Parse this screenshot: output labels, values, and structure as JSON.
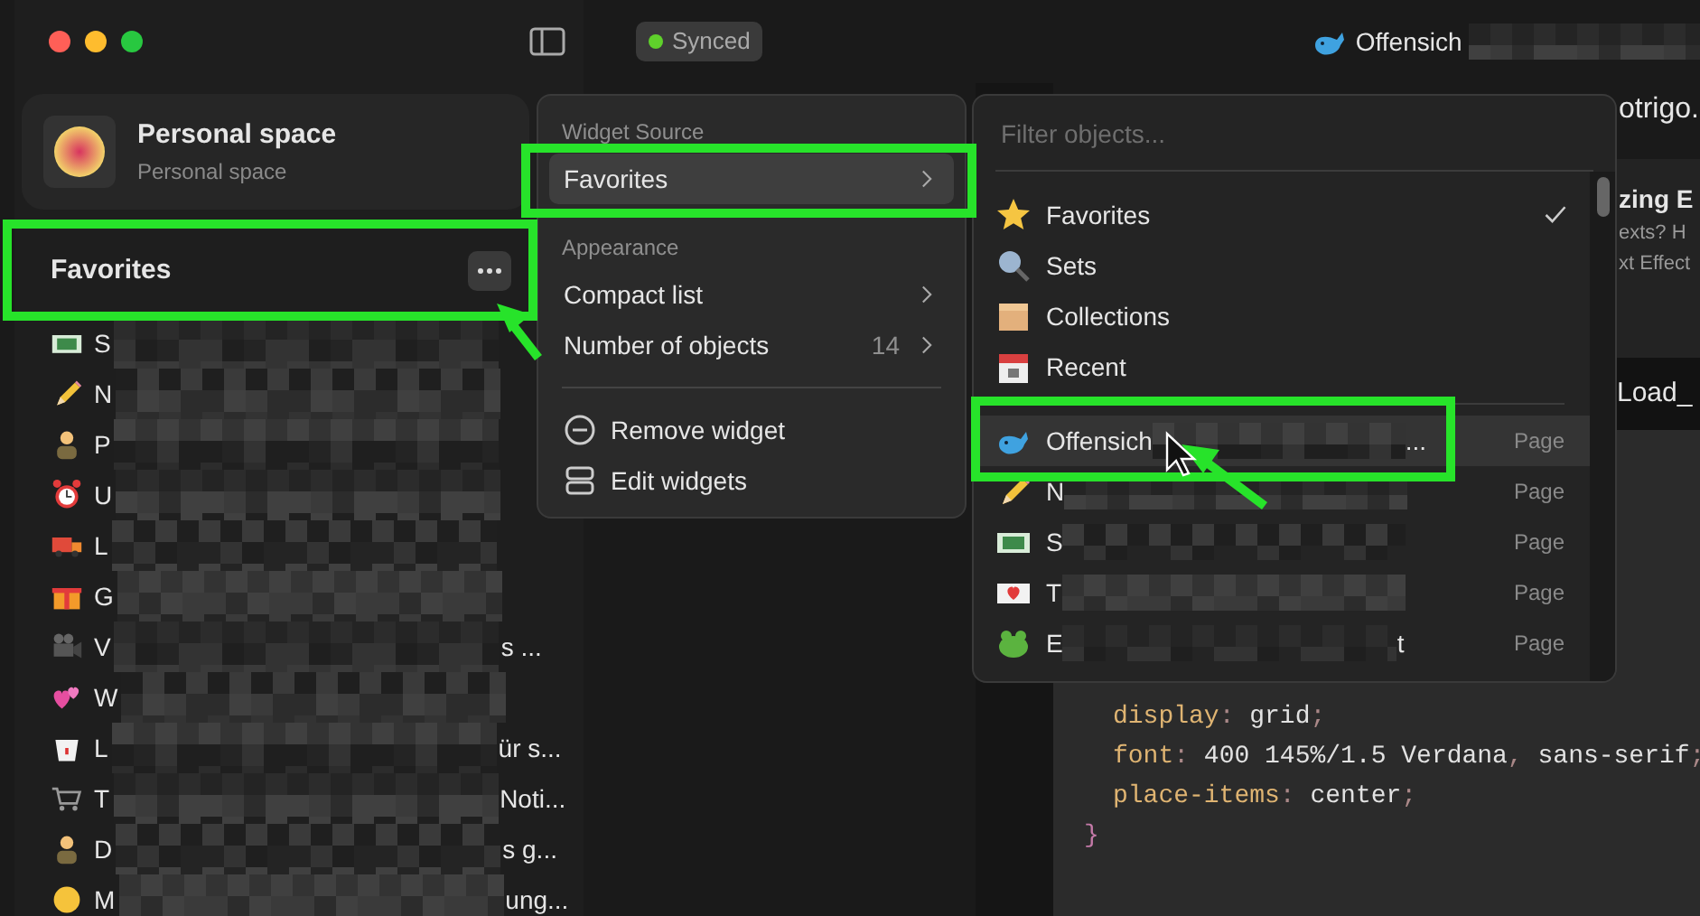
{
  "sidebar": {
    "space": {
      "title": "Personal space",
      "subtitle": "Personal space"
    },
    "widget": {
      "title": "Favorites",
      "items": [
        {
          "start": "S"
        },
        {
          "start": "N"
        },
        {
          "start": "P"
        },
        {
          "start": "U"
        },
        {
          "start": "L"
        },
        {
          "start": "G"
        },
        {
          "start": "V",
          "end": "s ..."
        },
        {
          "start": "W"
        },
        {
          "start": "L",
          "end": "ür s..."
        },
        {
          "start": "T",
          "end": "Noti..."
        },
        {
          "start": "D",
          "end": "s g..."
        },
        {
          "start": "M",
          "end": "ung..."
        }
      ]
    }
  },
  "toolbar": {
    "sync_status": "Synced",
    "title": "Offensich"
  },
  "background_page": {
    "url": "otrigo.",
    "heading": "zing E",
    "lines": [
      "exts? H",
      "xt Effect"
    ],
    "banner": "Load_"
  },
  "code": {
    "lines": [
      {
        "kind": "decl",
        "tokens": [
          {
            "kind": "prop",
            "text": "display"
          },
          {
            "kind": "punct",
            "text": ": "
          },
          {
            "kind": "value",
            "text": "grid"
          },
          {
            "kind": "punct",
            "text": ";"
          }
        ]
      },
      {
        "kind": "decl",
        "tokens": [
          {
            "kind": "prop",
            "text": "font"
          },
          {
            "kind": "punct",
            "text": ": "
          },
          {
            "kind": "value",
            "text": "400 145%/1.5 Verdana"
          },
          {
            "kind": "punct",
            "text": ", "
          },
          {
            "kind": "value",
            "text": "sans-serif"
          },
          {
            "kind": "punct",
            "text": ";"
          }
        ]
      },
      {
        "kind": "decl",
        "tokens": [
          {
            "kind": "prop",
            "text": "place-items"
          },
          {
            "kind": "punct",
            "text": ": "
          },
          {
            "kind": "value",
            "text": "center"
          },
          {
            "kind": "punct",
            "text": ";"
          }
        ]
      },
      {
        "kind": "rule",
        "tokens": [
          {
            "kind": "selector",
            "text": "}"
          }
        ]
      }
    ]
  },
  "widget_menu": {
    "sections": [
      {
        "header": "Widget Source",
        "items": [
          {
            "label": "Favorites",
            "kind": "submenu",
            "selected": true
          }
        ]
      },
      {
        "header": "Appearance",
        "items": [
          {
            "label": "Compact list",
            "kind": "submenu",
            "selected": false
          },
          {
            "label": "Number of objects",
            "value": "14",
            "kind": "submenu",
            "selected": false
          }
        ]
      },
      {
        "items": [
          {
            "label": "Remove widget",
            "kind": "action",
            "selected": false
          },
          {
            "label": "Edit widgets",
            "kind": "action",
            "selected": false
          }
        ]
      }
    ]
  },
  "source_menu": {
    "placeholder": "Filter objects...",
    "sources": [
      {
        "label": "Favorites",
        "checked": true
      },
      {
        "label": "Sets",
        "checked": false
      },
      {
        "label": "Collections",
        "checked": false
      },
      {
        "label": "Recent",
        "checked": false
      }
    ],
    "objects": [
      {
        "start": "Offensich",
        "end": "...",
        "type": "Page",
        "selected": true
      },
      {
        "start": "N",
        "type": "Page",
        "selected": false
      },
      {
        "start": "S",
        "type": "Page",
        "selected": false
      },
      {
        "start": "T",
        "type": "Page",
        "selected": false
      },
      {
        "start": "E",
        "end": "t",
        "type": "Page",
        "selected": false
      }
    ]
  }
}
